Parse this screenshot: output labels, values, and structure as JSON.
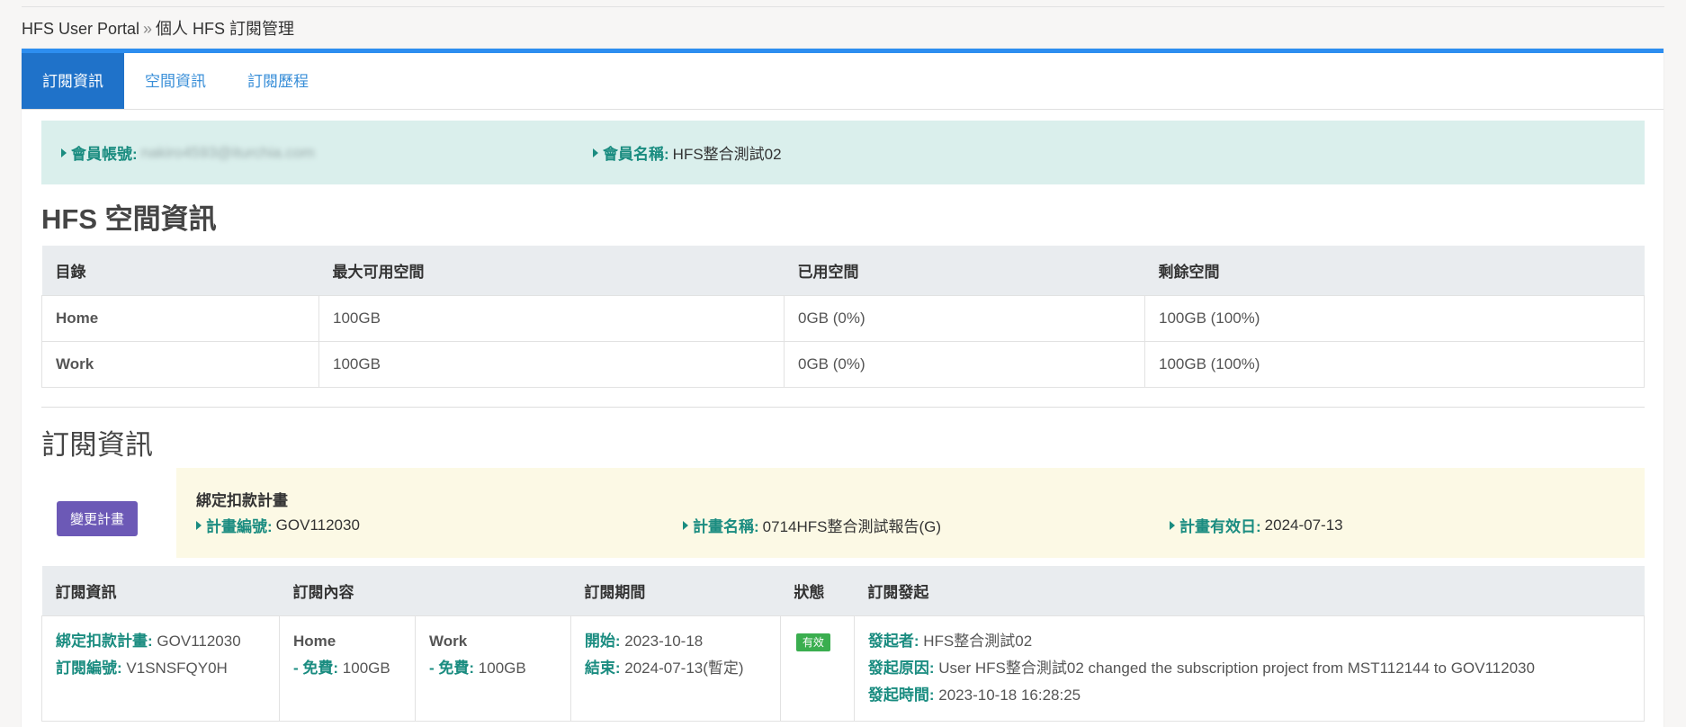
{
  "breadcrumb": {
    "root": "HFS User Portal",
    "separator": "»",
    "current": "個人 HFS 訂閱管理"
  },
  "tabs": [
    {
      "label": "訂閱資訊",
      "active": true
    },
    {
      "label": "空間資訊",
      "active": false
    },
    {
      "label": "訂閱歷程",
      "active": false
    }
  ],
  "member": {
    "account_label": "會員帳號:",
    "account_value": "nakiro4593@iturchia.com",
    "name_label": "會員名稱:",
    "name_value": "HFS整合測試02"
  },
  "space": {
    "heading": "HFS 空間資訊",
    "headers": [
      "目錄",
      "最大可用空間",
      "已用空間",
      "剩餘空間"
    ],
    "rows": [
      {
        "dir": "Home",
        "max": "100GB",
        "used": "0GB (0%)",
        "remaining": "100GB (100%)"
      },
      {
        "dir": "Work",
        "max": "100GB",
        "used": "0GB (0%)",
        "remaining": "100GB (100%)"
      }
    ]
  },
  "subscription": {
    "heading": "訂閱資訊",
    "change_button": "變更計畫",
    "plan": {
      "title": "綁定扣款計畫",
      "code_label": "計畫編號:",
      "code_value": "GOV112030",
      "name_label": "計畫名稱:",
      "name_value": "0714HFS整合測試報告(G)",
      "expiry_label": "計畫有效日:",
      "expiry_value": "2024-07-13"
    },
    "headers": [
      "訂閱資訊",
      "訂閱內容",
      "訂閱期間",
      "狀態",
      "訂閱發起"
    ],
    "row": {
      "bind_label": "綁定扣款計畫:",
      "bind_value": "GOV112030",
      "sub_no_label": "訂閱編號:",
      "sub_no_value": "V1SNSFQY0H",
      "home_title": "Home",
      "home_label": "- 免費:",
      "home_value": "100GB",
      "work_title": "Work",
      "work_label": "- 免費:",
      "work_value": "100GB",
      "start_label": "開始:",
      "start_value": "2023-10-18",
      "end_label": "結束:",
      "end_value": "2024-07-13(暫定)",
      "status": "有效",
      "initiator_label": "發起者:",
      "initiator_value": "HFS整合測試02",
      "reason_label": "發起原因:",
      "reason_value": "User HFS整合測試02 changed the subscription project from MST112144 to GOV112030",
      "time_label": "發起時間:",
      "time_value": "2023-10-18 16:28:25"
    }
  },
  "colors": {
    "accent": "#2d8ef0",
    "tab_active": "#1f72c9",
    "label_teal": "#1a8c80",
    "button_purple": "#6c59b6",
    "status_green": "#3aae4f"
  }
}
